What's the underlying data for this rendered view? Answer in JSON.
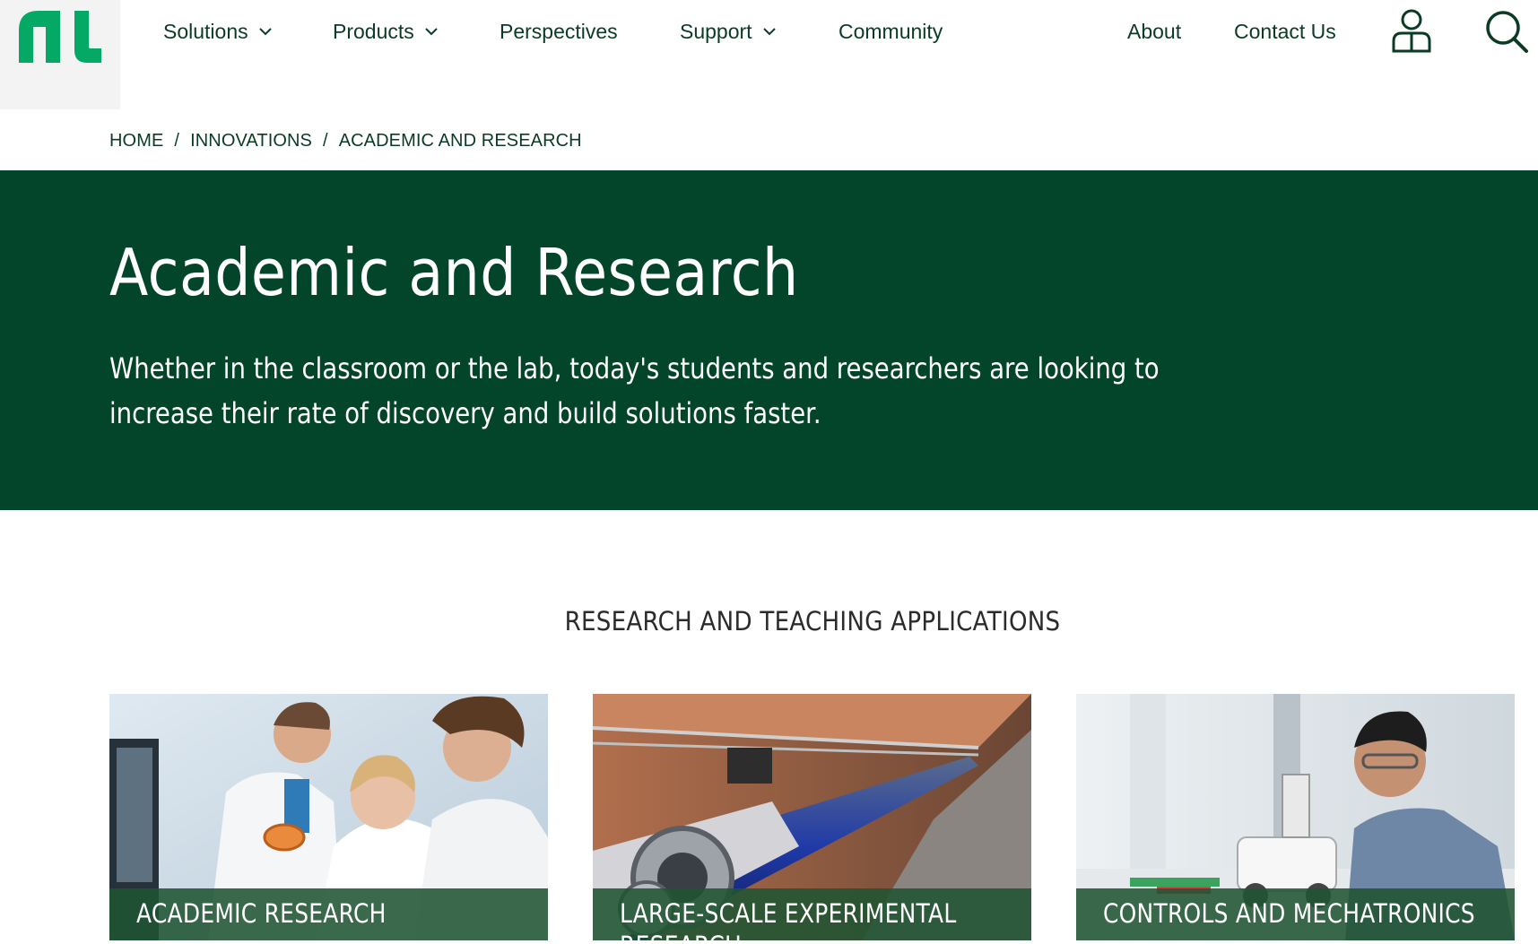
{
  "brand": {
    "accent": "#03a964",
    "dark_green": "#03452a"
  },
  "nav": {
    "items": [
      {
        "label": "Solutions",
        "has_dropdown": true
      },
      {
        "label": "Products",
        "has_dropdown": true
      },
      {
        "label": "Perspectives",
        "has_dropdown": false
      },
      {
        "label": "Support",
        "has_dropdown": true
      },
      {
        "label": "Community",
        "has_dropdown": false
      }
    ],
    "about": "About",
    "contact": "Contact Us",
    "account_icon": "user-icon",
    "search_icon": "search-icon"
  },
  "breadcrumb": {
    "items": [
      "HOME",
      "INNOVATIONS",
      "ACADEMIC AND RESEARCH"
    ],
    "separator": "/"
  },
  "hero": {
    "title": "Academic and Research",
    "description": "Whether in the classroom or the lab, today's students and researchers are looking to increase their rate of discovery and build solutions faster."
  },
  "section": {
    "heading": "RESEARCH AND TEACHING APPLICATIONS",
    "cards": [
      {
        "caption": "ACADEMIC RESEARCH"
      },
      {
        "caption": "LARGE-SCALE EXPERIMENTAL RESEARCH"
      },
      {
        "caption": "CONTROLS AND MECHATRONICS"
      }
    ]
  }
}
